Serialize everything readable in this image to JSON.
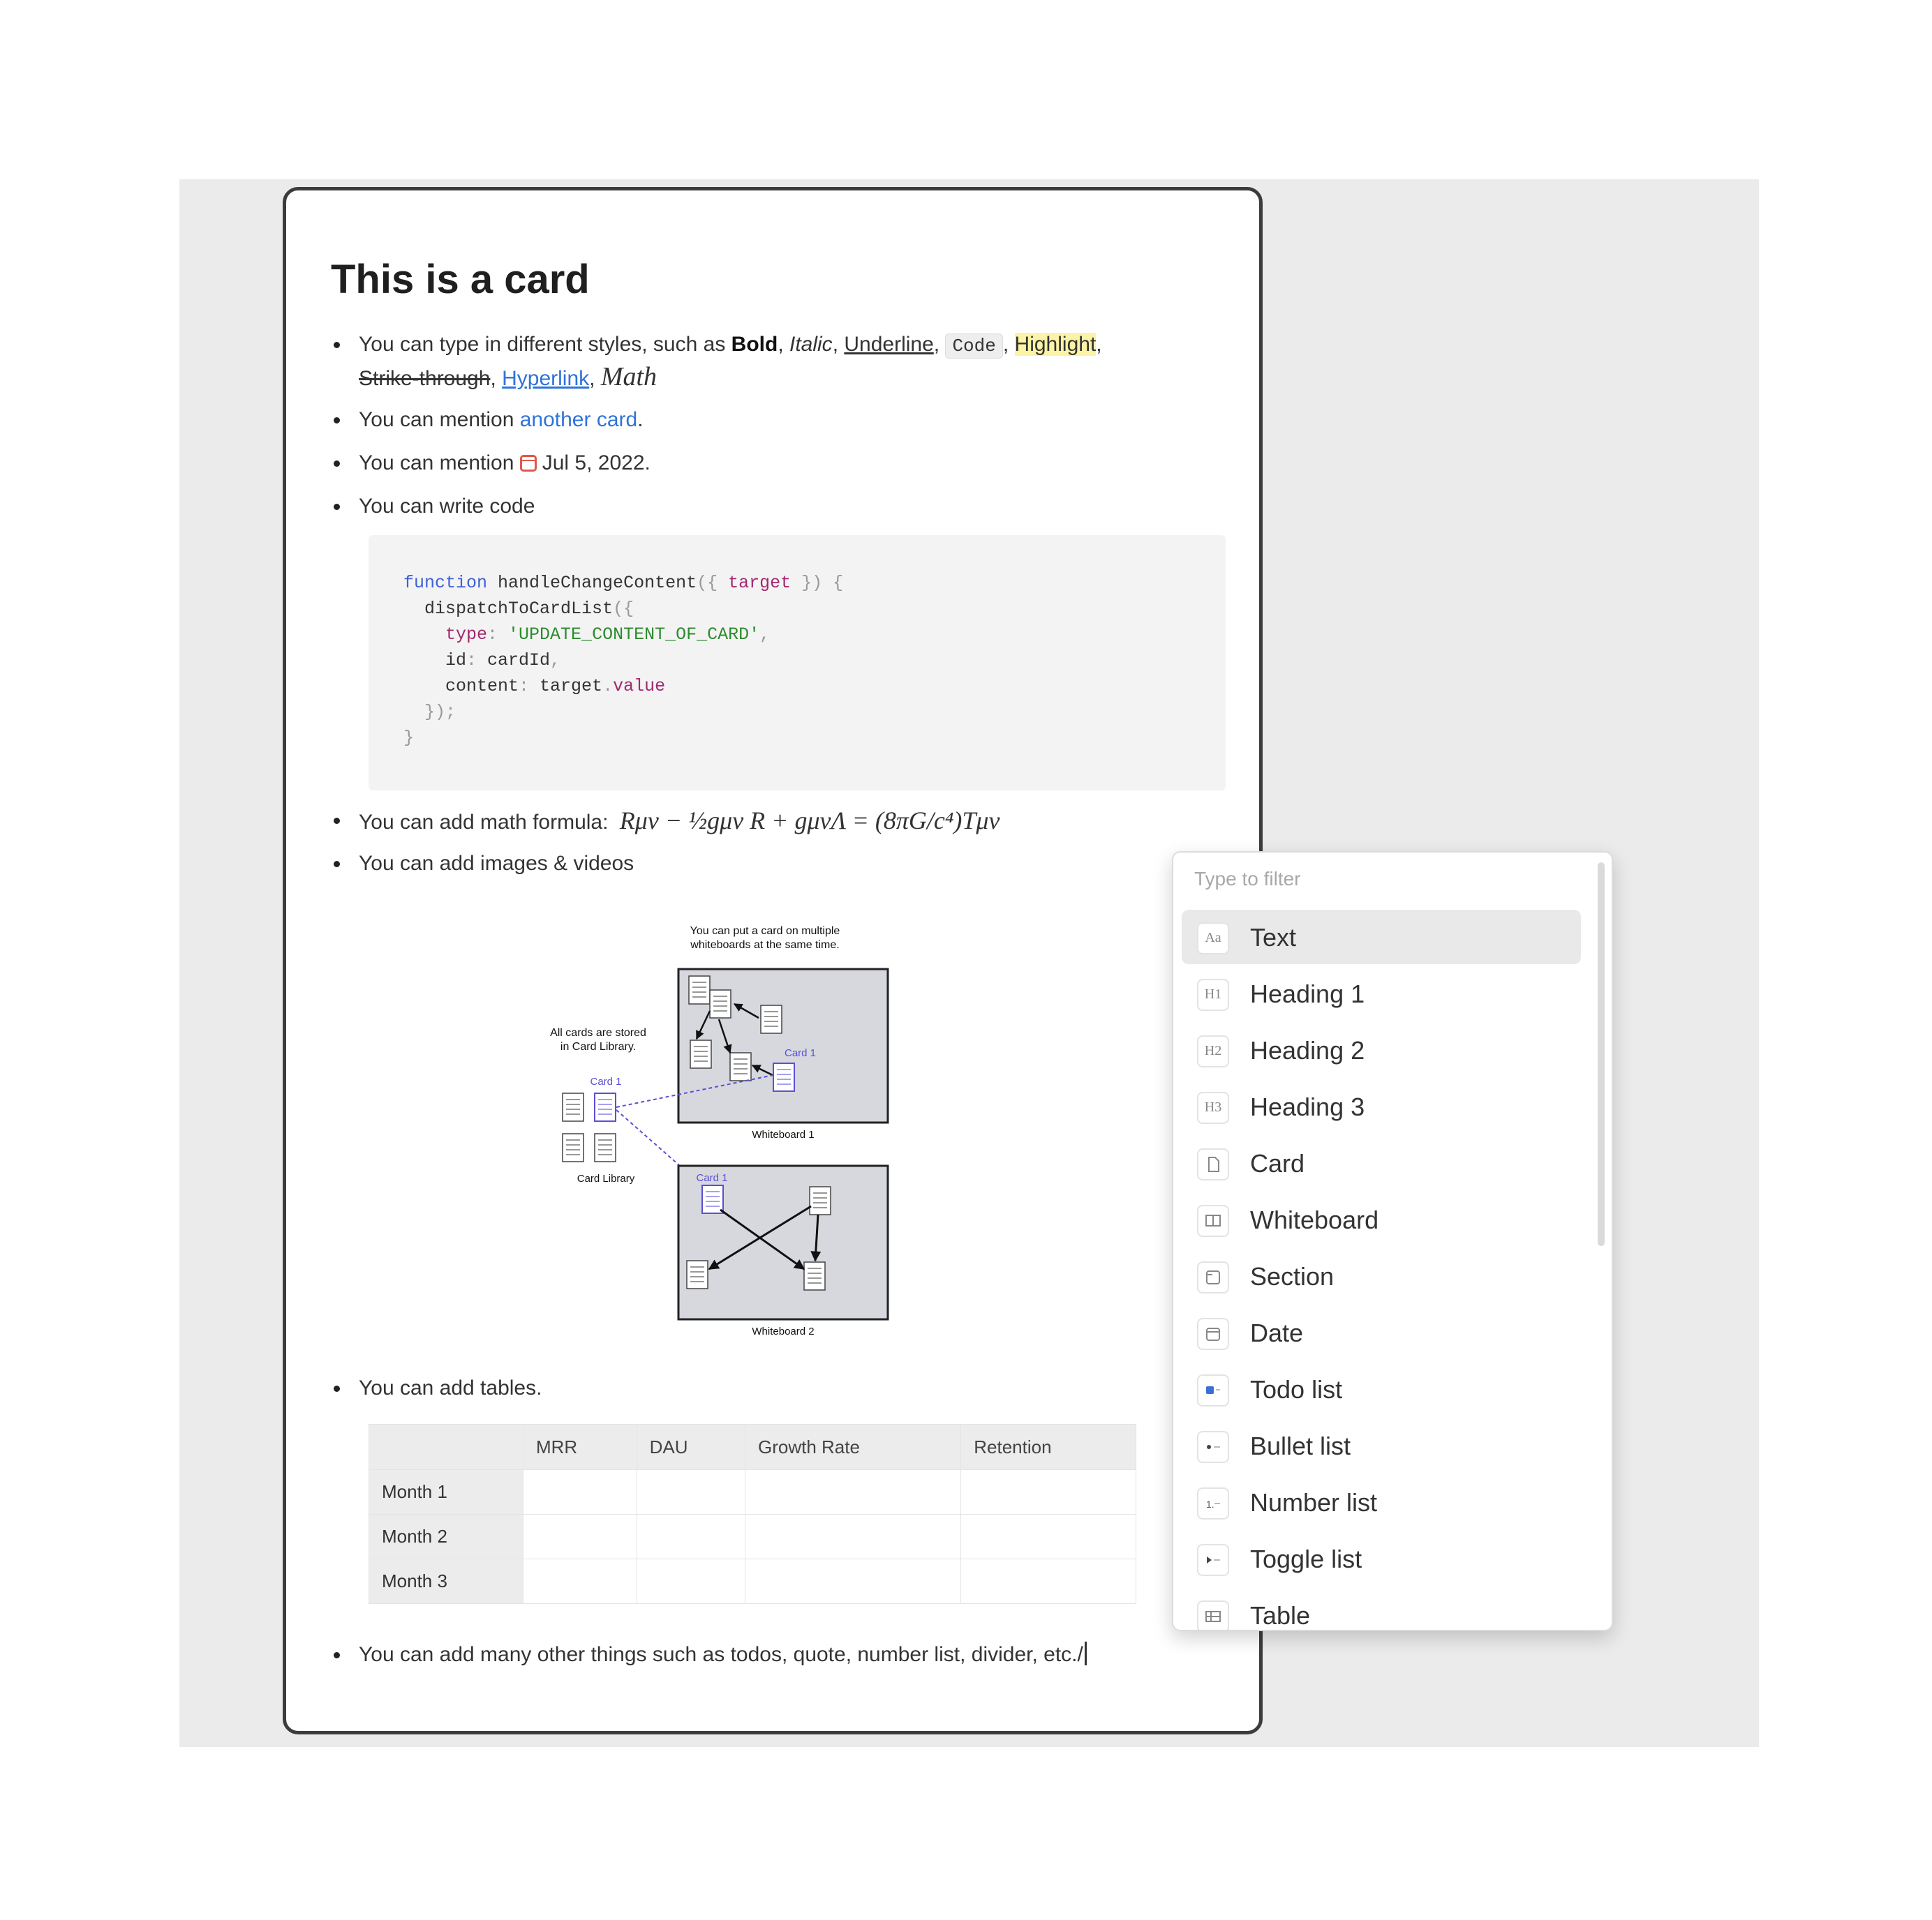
{
  "card": {
    "title": "This is a card",
    "b1": {
      "prefix": "You can type in different styles, such as ",
      "bold": "Bold",
      "italic": "Italic",
      "underline": "Underline",
      "code": "Code",
      "highlight": "Highlight",
      "strike": "Strike-through",
      "link": "Hyperlink",
      "math": "Math",
      "sep": ", ",
      "sep2": ","
    },
    "b2": {
      "prefix": "You can mention ",
      "link": "another card",
      "suffix": "."
    },
    "b3": {
      "prefix": "You can mention ",
      "date": "Jul 5, 2022",
      "suffix": "."
    },
    "b4": {
      "text": "You can write code"
    },
    "code": {
      "l1_kw": "function",
      "l1_fn": " handleChangeContent",
      "l1_p1": "({ ",
      "l1_param": "target",
      "l1_p2": " }) {",
      "l2": "  dispatchToCardList",
      "l2_p": "({",
      "l3_key": "    type",
      "l3_c": ": ",
      "l3_val": "'UPDATE_CONTENT_OF_CARD'",
      "l3_comma": ",",
      "l4_key": "    id",
      "l4_c": ": ",
      "l4_val": "cardId",
      "l4_comma": ",",
      "l5_key": "    content",
      "l5_c": ": ",
      "l5_obj": "target",
      "l5_dot": ".",
      "l5_prop": "value",
      "l6": "  });",
      "l7": "}"
    },
    "b5": {
      "prefix": "You can add math formula: ",
      "formula": "Rμν − ½gμν R + gμνΛ = (8πG/c⁴)Tμν"
    },
    "b6": {
      "text": "You can add images & videos"
    },
    "figure": {
      "top_note": [
        "You can put a card on multiple",
        "whiteboards at the same time."
      ],
      "library_note": [
        "All cards are stored",
        "in Card Library."
      ],
      "card_label": "Card 1",
      "whiteboard1": "Whiteboard 1",
      "whiteboard2": "Whiteboard 2",
      "library": "Card Library"
    },
    "b7": {
      "text": "You can add tables."
    },
    "table": {
      "headers": [
        "",
        "MRR",
        "DAU",
        "Growth Rate",
        "Retention"
      ],
      "rows": [
        "Month 1",
        "Month 2",
        "Month 3"
      ]
    },
    "b8": {
      "text": "You can add many other things such as todos, quote, number list, divider, etc./"
    }
  },
  "menu": {
    "placeholder": "Type to filter",
    "items": [
      {
        "label": "Text",
        "icon": "Aa"
      },
      {
        "label": "Heading 1",
        "icon": "H1"
      },
      {
        "label": "Heading 2",
        "icon": "H2"
      },
      {
        "label": "Heading 3",
        "icon": "H3"
      },
      {
        "label": "Card",
        "icon": "card-icon"
      },
      {
        "label": "Whiteboard",
        "icon": "whiteboard-icon"
      },
      {
        "label": "Section",
        "icon": "section-icon"
      },
      {
        "label": "Date",
        "icon": "calendar-icon"
      },
      {
        "label": "Todo list",
        "icon": "checkbox-icon"
      },
      {
        "label": "Bullet list",
        "icon": "bullet-icon"
      },
      {
        "label": "Number list",
        "icon": "number-icon"
      },
      {
        "label": "Toggle list",
        "icon": "toggle-icon"
      },
      {
        "label": "Table",
        "icon": "table-icon"
      }
    ]
  },
  "colors": {
    "link": "#2f73d8",
    "highlight": "#fbf3a6",
    "date_icon": "#e0584a",
    "figure_accent": "#5b4fd6"
  }
}
